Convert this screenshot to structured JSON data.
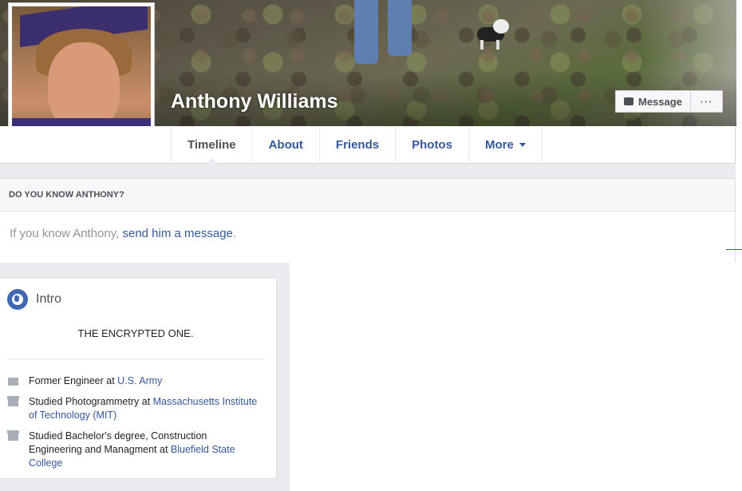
{
  "profile": {
    "name": "Anthony Williams"
  },
  "actions": {
    "message_label": "Message",
    "more_label": "···"
  },
  "tabs": [
    {
      "label": "Timeline"
    },
    {
      "label": "About"
    },
    {
      "label": "Friends"
    },
    {
      "label": "Photos"
    },
    {
      "label": "More"
    }
  ],
  "know_box": {
    "heading": "DO YOU KNOW ANTHONY?",
    "text_before": "If you know Anthony, ",
    "link": "send him a message",
    "text_after": "."
  },
  "intro": {
    "title": "Intro",
    "bio": "THE ENCRYPTED ONE.",
    "items": [
      {
        "icon": "briefcase-icon",
        "prefix": "Former Engineer at ",
        "link": "U.S. Army"
      },
      {
        "icon": "graduation-cap-icon",
        "prefix": "Studied Photogrammetry at ",
        "link": "Massachusetts Institute of Technology (MIT)"
      },
      {
        "icon": "graduation-cap-icon",
        "prefix": "Studied Bachelor's degree, Construction Engineering and Managment at ",
        "link": "Bluefield State College"
      }
    ]
  },
  "colors": {
    "link": "#365899",
    "page_bg": "#e9ebee"
  }
}
